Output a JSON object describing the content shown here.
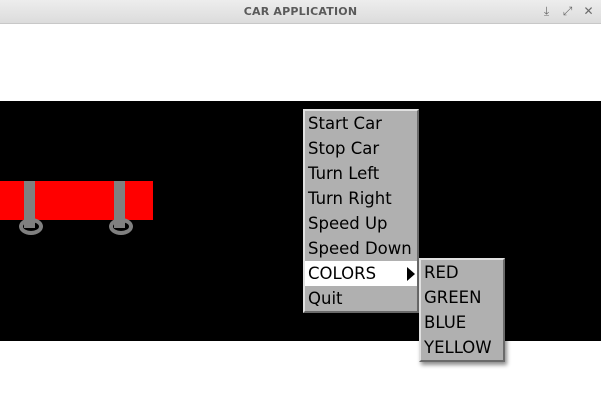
{
  "window": {
    "title": "CAR APPLICATION",
    "controls": [
      {
        "name": "minimize-icon",
        "glyph": "⤓"
      },
      {
        "name": "maximize-icon",
        "glyph": "⤢"
      },
      {
        "name": "close-icon",
        "glyph": "✕"
      }
    ]
  },
  "scene": {
    "background_color": "#000000",
    "car_color": "#ff0000",
    "wheel_color": "#808080"
  },
  "menu": {
    "items": [
      {
        "label": "Start Car"
      },
      {
        "label": "Stop Car"
      },
      {
        "label": "Turn Left"
      },
      {
        "label": "Turn Right"
      },
      {
        "label": "Speed Up"
      },
      {
        "label": "Speed Down"
      },
      {
        "label": "COLORS",
        "submenu": true,
        "active": true
      },
      {
        "label": "Quit"
      }
    ]
  },
  "colors_submenu": {
    "items": [
      {
        "label": "RED"
      },
      {
        "label": "GREEN"
      },
      {
        "label": "BLUE"
      },
      {
        "label": "YELLOW"
      }
    ]
  }
}
